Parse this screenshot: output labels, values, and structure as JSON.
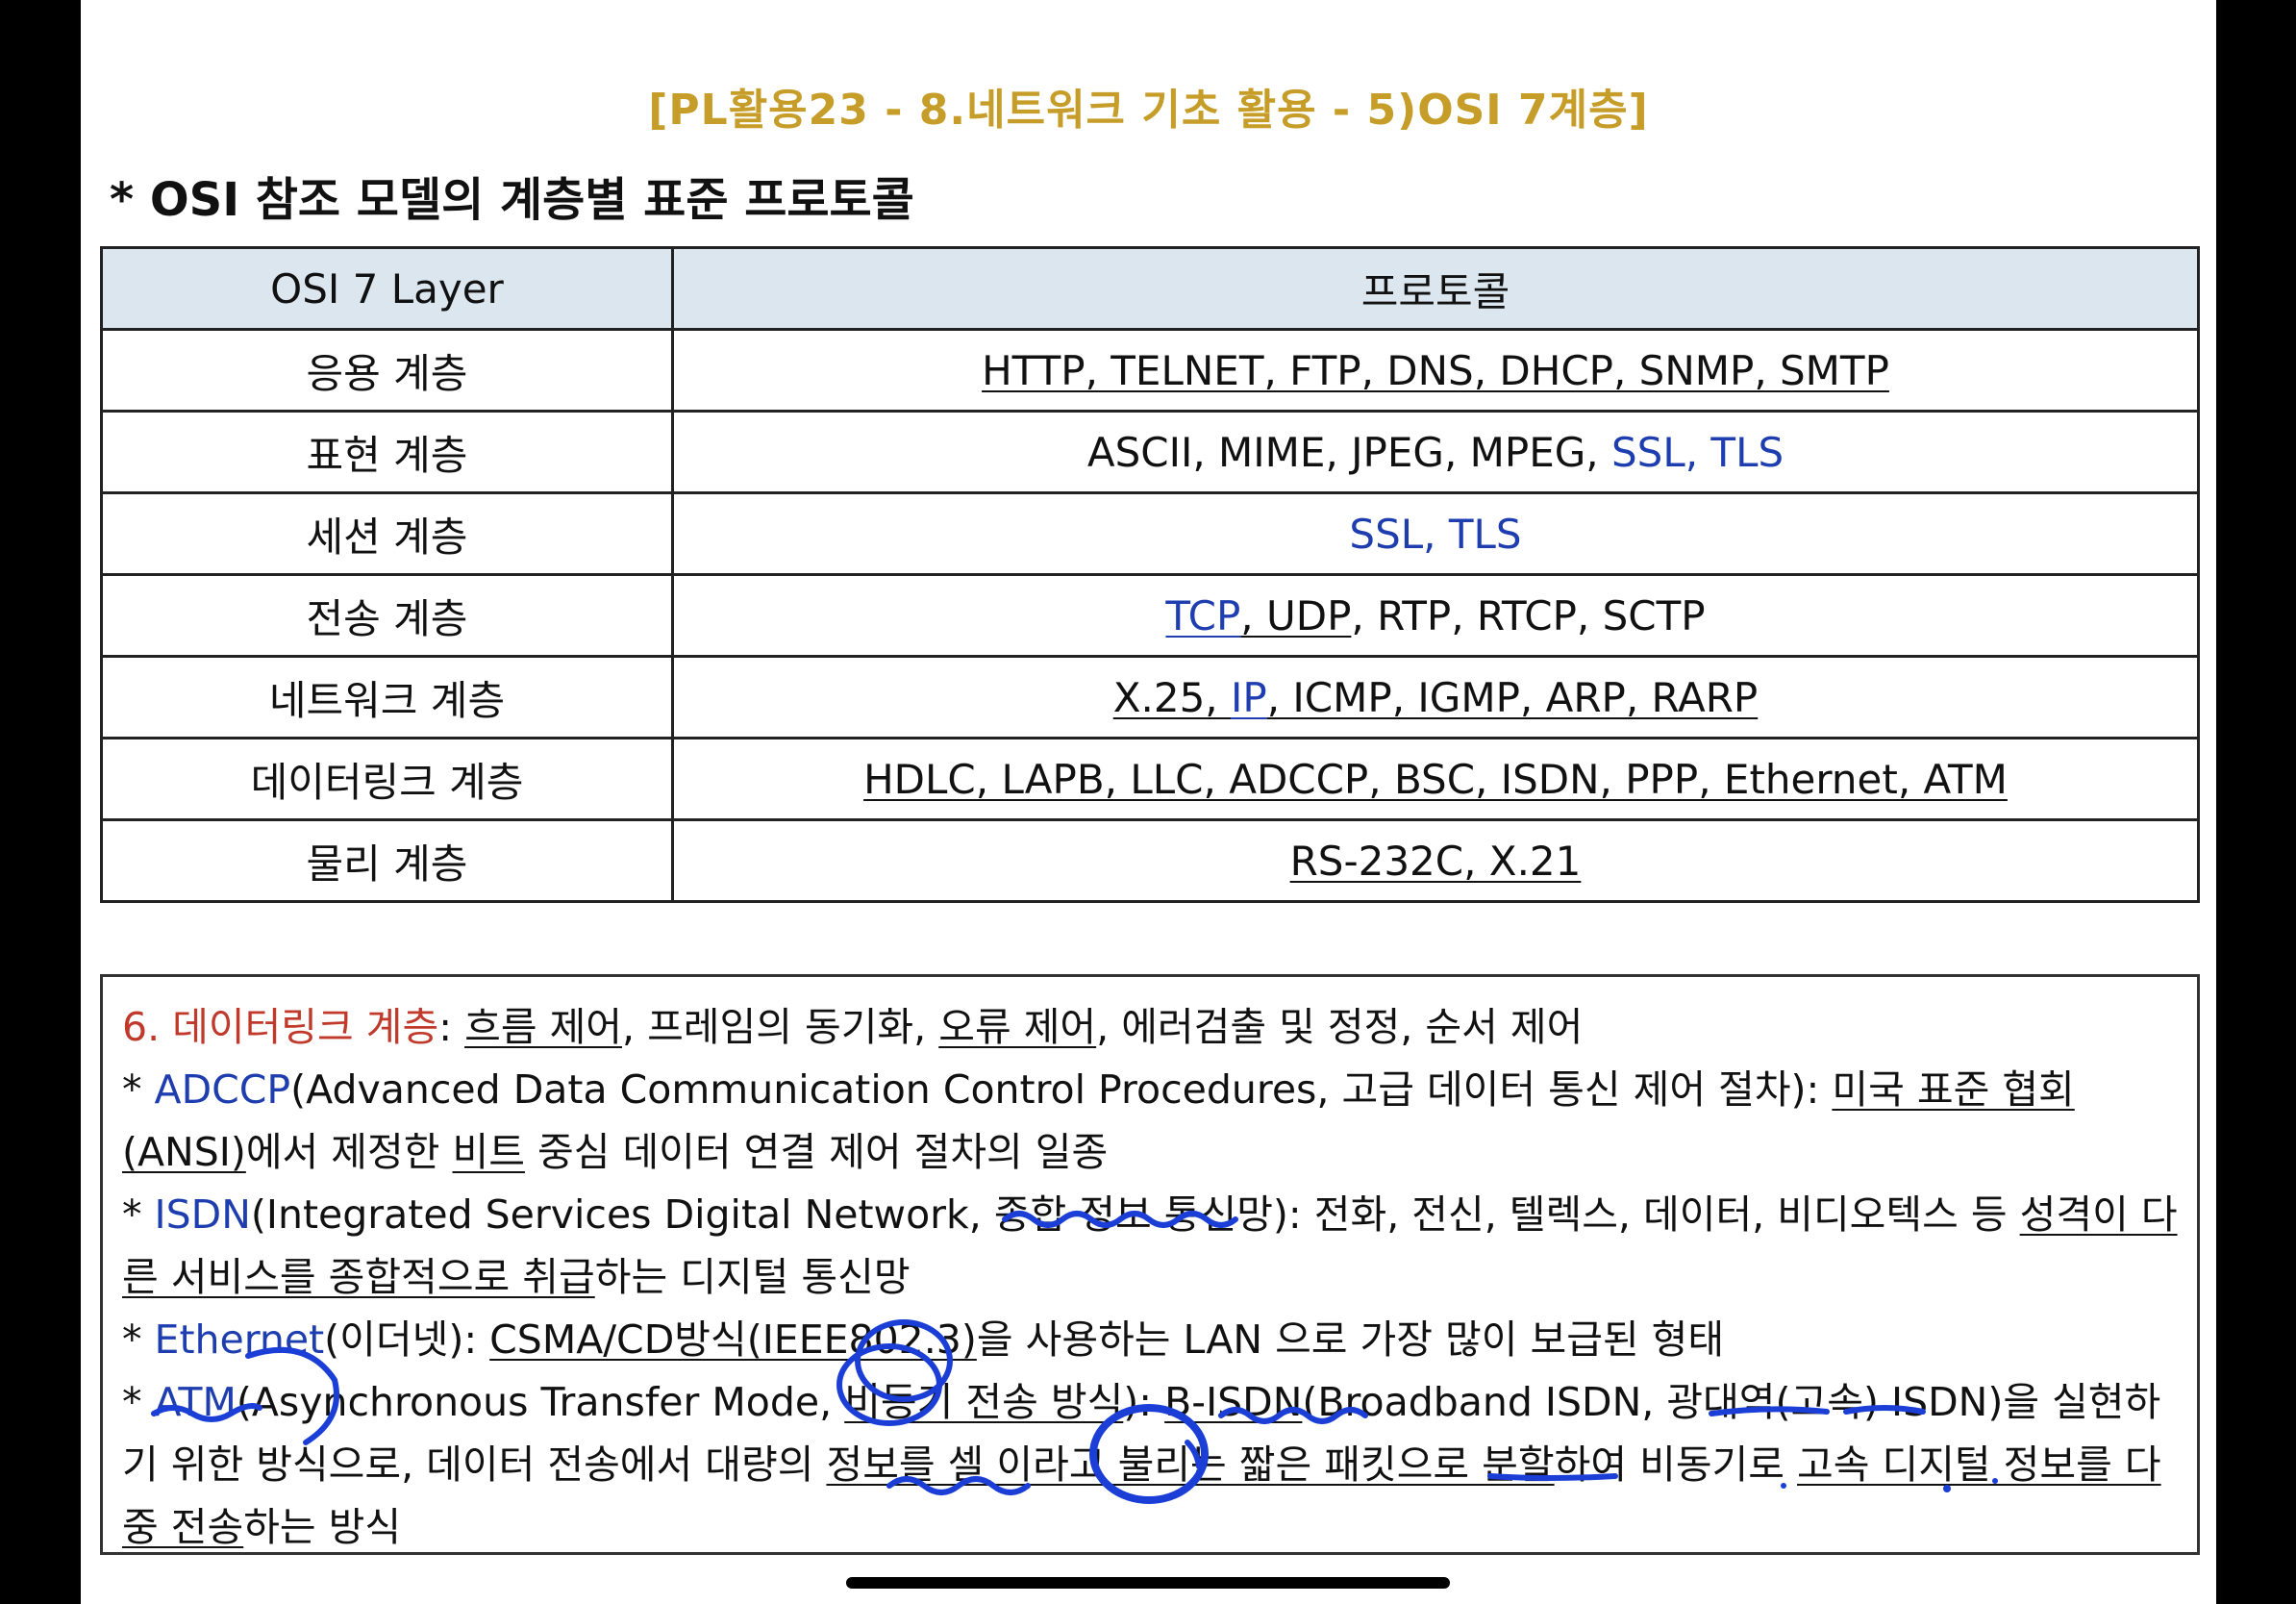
{
  "header": {
    "title": "[PL활용23 - 8.네트워크 기초 활용 - 5)OSI 7계층]",
    "section": "* OSI 참조 모델의 계층별 표준 프로토콜"
  },
  "table": {
    "col1": "OSI 7 Layer",
    "col2": "프로토콜",
    "rows": [
      {
        "layer": "응용 계층",
        "protocols": "HTTP, TELNET, FTP, DNS, DHCP, SNMP, SMTP"
      },
      {
        "layer": "표현 계층",
        "p1": "ASCII, MIME, JPEG, MPEG, ",
        "p2": "SSL, TLS"
      },
      {
        "layer": "세션 계층",
        "protocols": "SSL, TLS"
      },
      {
        "layer": "전송 계층",
        "p1": "TCP",
        "p2": ", UDP",
        "p3": ", RTP, RTCP, SCTP"
      },
      {
        "layer": "네트워크 계층",
        "p1": "X.25, ",
        "p2": "IP",
        "p3": ", ICMP, IGMP, ARP, RARP"
      },
      {
        "layer": "데이터링크 계층",
        "protocols": "HDLC, LAPB, LLC, ADCCP, BSC, ISDN, PPP, Ethernet, ATM"
      },
      {
        "layer": "물리 계층",
        "protocols": "RS-232C, X.21"
      }
    ]
  },
  "notes": {
    "l1_head": "6. 데이터링크 계층",
    "l1_a": ": ",
    "l1_b": "흐름 제어",
    "l1_c": ", 프레임의 동기화, ",
    "l1_d": "오류 제어",
    "l1_e": ", 에러검출 및 정정, 순서 제어",
    "l2_star": "* ",
    "l2_name": "ADCCP",
    "l2_a": "(Advanced Data Communication  Control Procedures, 고급 데이터 통신 제어 절차): ",
    "l2_b": "미국 표준 협회 (ANSI)",
    "l2_c": "에서 제정한 ",
    "l2_d": "비트",
    "l2_e": " 중심 데이터 연결 제어 절차의 일종",
    "l3_star": "* ",
    "l3_name": "ISDN",
    "l3_a": "(Integrated Services Digital Network, 종합 정보 통신망): 전화, 전신, 텔렉스, 데이터, 비디오텍스 등 ",
    "l3_b": "성격이 다른 서비스를 종합적으로 취급",
    "l3_c": "하는 디지털 통신망",
    "l4_star": "* ",
    "l4_name": "Ethernet",
    "l4_a": "(이더넷): ",
    "l4_b": "CSMA/CD방식(IEEE802.3)",
    "l4_c": "을 사용하는 LAN 으로 가장 많이 보급된 형태",
    "l5_star": "* ",
    "l5_name": "ATM",
    "l5_a": "(Asynchronous Transfer Mode, ",
    "l5_b": "비동기 전송 방식",
    "l5_c": "): ",
    "l5_d": "B-ISDN",
    "l5_e": "(Broadband  ISDN, 광대역(고속) ISDN)을 실현하기 위한 방식으로, 데이터 전송에서 대량의 ",
    "l5_f": "정보를 셀 이라고 불리는 짧은 패킷으로 분할",
    "l5_g": "하여 비동기로 ",
    "l5_h": "고속 디지털 정보를 다중 전송",
    "l5_i": "하는 방식"
  },
  "colors": {
    "title": "#c69d28",
    "accent_blue": "#1e3eb0",
    "accent_red": "#c0392b",
    "header_bg": "#dce6ee",
    "ink": "#1a3ed6"
  }
}
